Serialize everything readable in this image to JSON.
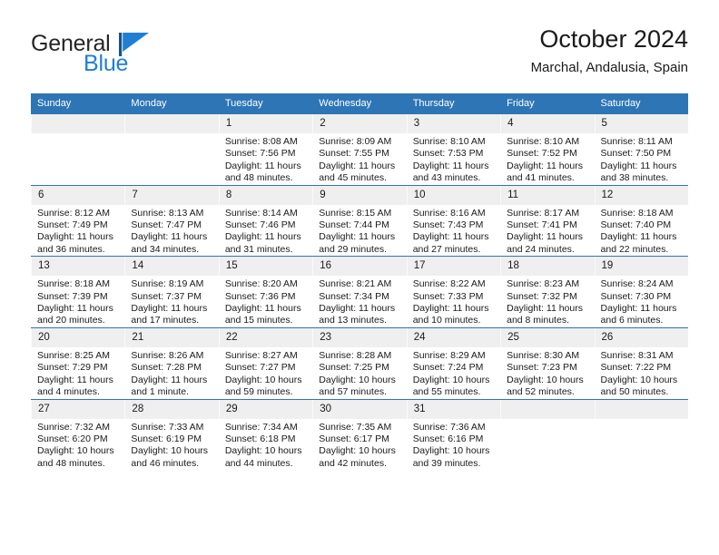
{
  "brand": {
    "name_part1": "General",
    "name_part2": "Blue",
    "logo_icon": "triangle-flag-icon",
    "accent_color": "#1f7fd4"
  },
  "header": {
    "title": "October 2024",
    "location": "Marchal, Andalusia, Spain"
  },
  "calendar": {
    "header_color": "#2e75b6",
    "daynum_band_color": "#efefef",
    "weekday_headers": [
      "Sunday",
      "Monday",
      "Tuesday",
      "Wednesday",
      "Thursday",
      "Friday",
      "Saturday"
    ],
    "weeks": [
      [
        {
          "day": "",
          "empty": true,
          "sunrise": "",
          "sunset": "",
          "daylight": ""
        },
        {
          "day": "",
          "empty": true,
          "sunrise": "",
          "sunset": "",
          "daylight": ""
        },
        {
          "day": "1",
          "empty": false,
          "sunrise": "Sunrise: 8:08 AM",
          "sunset": "Sunset: 7:56 PM",
          "daylight": "Daylight: 11 hours and 48 minutes."
        },
        {
          "day": "2",
          "empty": false,
          "sunrise": "Sunrise: 8:09 AM",
          "sunset": "Sunset: 7:55 PM",
          "daylight": "Daylight: 11 hours and 45 minutes."
        },
        {
          "day": "3",
          "empty": false,
          "sunrise": "Sunrise: 8:10 AM",
          "sunset": "Sunset: 7:53 PM",
          "daylight": "Daylight: 11 hours and 43 minutes."
        },
        {
          "day": "4",
          "empty": false,
          "sunrise": "Sunrise: 8:10 AM",
          "sunset": "Sunset: 7:52 PM",
          "daylight": "Daylight: 11 hours and 41 minutes."
        },
        {
          "day": "5",
          "empty": false,
          "sunrise": "Sunrise: 8:11 AM",
          "sunset": "Sunset: 7:50 PM",
          "daylight": "Daylight: 11 hours and 38 minutes."
        }
      ],
      [
        {
          "day": "6",
          "empty": false,
          "sunrise": "Sunrise: 8:12 AM",
          "sunset": "Sunset: 7:49 PM",
          "daylight": "Daylight: 11 hours and 36 minutes."
        },
        {
          "day": "7",
          "empty": false,
          "sunrise": "Sunrise: 8:13 AM",
          "sunset": "Sunset: 7:47 PM",
          "daylight": "Daylight: 11 hours and 34 minutes."
        },
        {
          "day": "8",
          "empty": false,
          "sunrise": "Sunrise: 8:14 AM",
          "sunset": "Sunset: 7:46 PM",
          "daylight": "Daylight: 11 hours and 31 minutes."
        },
        {
          "day": "9",
          "empty": false,
          "sunrise": "Sunrise: 8:15 AM",
          "sunset": "Sunset: 7:44 PM",
          "daylight": "Daylight: 11 hours and 29 minutes."
        },
        {
          "day": "10",
          "empty": false,
          "sunrise": "Sunrise: 8:16 AM",
          "sunset": "Sunset: 7:43 PM",
          "daylight": "Daylight: 11 hours and 27 minutes."
        },
        {
          "day": "11",
          "empty": false,
          "sunrise": "Sunrise: 8:17 AM",
          "sunset": "Sunset: 7:41 PM",
          "daylight": "Daylight: 11 hours and 24 minutes."
        },
        {
          "day": "12",
          "empty": false,
          "sunrise": "Sunrise: 8:18 AM",
          "sunset": "Sunset: 7:40 PM",
          "daylight": "Daylight: 11 hours and 22 minutes."
        }
      ],
      [
        {
          "day": "13",
          "empty": false,
          "sunrise": "Sunrise: 8:18 AM",
          "sunset": "Sunset: 7:39 PM",
          "daylight": "Daylight: 11 hours and 20 minutes."
        },
        {
          "day": "14",
          "empty": false,
          "sunrise": "Sunrise: 8:19 AM",
          "sunset": "Sunset: 7:37 PM",
          "daylight": "Daylight: 11 hours and 17 minutes."
        },
        {
          "day": "15",
          "empty": false,
          "sunrise": "Sunrise: 8:20 AM",
          "sunset": "Sunset: 7:36 PM",
          "daylight": "Daylight: 11 hours and 15 minutes."
        },
        {
          "day": "16",
          "empty": false,
          "sunrise": "Sunrise: 8:21 AM",
          "sunset": "Sunset: 7:34 PM",
          "daylight": "Daylight: 11 hours and 13 minutes."
        },
        {
          "day": "17",
          "empty": false,
          "sunrise": "Sunrise: 8:22 AM",
          "sunset": "Sunset: 7:33 PM",
          "daylight": "Daylight: 11 hours and 10 minutes."
        },
        {
          "day": "18",
          "empty": false,
          "sunrise": "Sunrise: 8:23 AM",
          "sunset": "Sunset: 7:32 PM",
          "daylight": "Daylight: 11 hours and 8 minutes."
        },
        {
          "day": "19",
          "empty": false,
          "sunrise": "Sunrise: 8:24 AM",
          "sunset": "Sunset: 7:30 PM",
          "daylight": "Daylight: 11 hours and 6 minutes."
        }
      ],
      [
        {
          "day": "20",
          "empty": false,
          "sunrise": "Sunrise: 8:25 AM",
          "sunset": "Sunset: 7:29 PM",
          "daylight": "Daylight: 11 hours and 4 minutes."
        },
        {
          "day": "21",
          "empty": false,
          "sunrise": "Sunrise: 8:26 AM",
          "sunset": "Sunset: 7:28 PM",
          "daylight": "Daylight: 11 hours and 1 minute."
        },
        {
          "day": "22",
          "empty": false,
          "sunrise": "Sunrise: 8:27 AM",
          "sunset": "Sunset: 7:27 PM",
          "daylight": "Daylight: 10 hours and 59 minutes."
        },
        {
          "day": "23",
          "empty": false,
          "sunrise": "Sunrise: 8:28 AM",
          "sunset": "Sunset: 7:25 PM",
          "daylight": "Daylight: 10 hours and 57 minutes."
        },
        {
          "day": "24",
          "empty": false,
          "sunrise": "Sunrise: 8:29 AM",
          "sunset": "Sunset: 7:24 PM",
          "daylight": "Daylight: 10 hours and 55 minutes."
        },
        {
          "day": "25",
          "empty": false,
          "sunrise": "Sunrise: 8:30 AM",
          "sunset": "Sunset: 7:23 PM",
          "daylight": "Daylight: 10 hours and 52 minutes."
        },
        {
          "day": "26",
          "empty": false,
          "sunrise": "Sunrise: 8:31 AM",
          "sunset": "Sunset: 7:22 PM",
          "daylight": "Daylight: 10 hours and 50 minutes."
        }
      ],
      [
        {
          "day": "27",
          "empty": false,
          "sunrise": "Sunrise: 7:32 AM",
          "sunset": "Sunset: 6:20 PM",
          "daylight": "Daylight: 10 hours and 48 minutes."
        },
        {
          "day": "28",
          "empty": false,
          "sunrise": "Sunrise: 7:33 AM",
          "sunset": "Sunset: 6:19 PM",
          "daylight": "Daylight: 10 hours and 46 minutes."
        },
        {
          "day": "29",
          "empty": false,
          "sunrise": "Sunrise: 7:34 AM",
          "sunset": "Sunset: 6:18 PM",
          "daylight": "Daylight: 10 hours and 44 minutes."
        },
        {
          "day": "30",
          "empty": false,
          "sunrise": "Sunrise: 7:35 AM",
          "sunset": "Sunset: 6:17 PM",
          "daylight": "Daylight: 10 hours and 42 minutes."
        },
        {
          "day": "31",
          "empty": false,
          "sunrise": "Sunrise: 7:36 AM",
          "sunset": "Sunset: 6:16 PM",
          "daylight": "Daylight: 10 hours and 39 minutes."
        },
        {
          "day": "",
          "empty": true,
          "sunrise": "",
          "sunset": "",
          "daylight": ""
        },
        {
          "day": "",
          "empty": true,
          "sunrise": "",
          "sunset": "",
          "daylight": ""
        }
      ]
    ]
  }
}
